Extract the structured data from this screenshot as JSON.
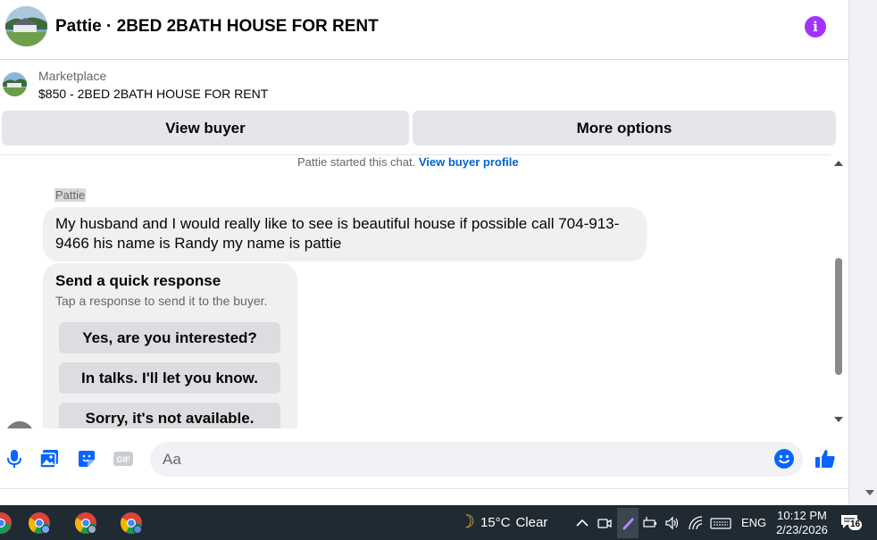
{
  "header": {
    "title": "Pattie · 2BED 2BATH HOUSE FOR RENT",
    "info_glyph": "i"
  },
  "listing": {
    "source": "Marketplace",
    "price_title": "$850 - 2BED 2BATH HOUSE FOR RENT"
  },
  "actions": {
    "view_buyer": "View buyer",
    "more_options": "More options"
  },
  "chat": {
    "system_text": "Pattie started this chat.",
    "system_link": "View buyer profile",
    "sender": "Pattie",
    "message": "My husband and I would really  like to see is beautiful  house if possible  call 704-913-9466 his name is Randy my name is pattie",
    "quick_title": "Send a quick response",
    "quick_subtitle": "Tap a response to send it to the buyer.",
    "quick_options": [
      "Yes, are you interested?",
      "In talks. I'll let you know.",
      "Sorry, it's not available."
    ]
  },
  "composer": {
    "placeholder": "Aa",
    "icons": [
      "microphone-icon",
      "photo-icon",
      "sticker-icon",
      "gif-icon",
      "emoji-icon",
      "thumbs-up-icon"
    ],
    "accent_color": "#0866ff"
  },
  "taskbar": {
    "temperature": "15°C",
    "weather": "Clear",
    "language": "ENG",
    "time": "10:12 PM",
    "date": "2/23/2026",
    "notification_count": "16"
  }
}
